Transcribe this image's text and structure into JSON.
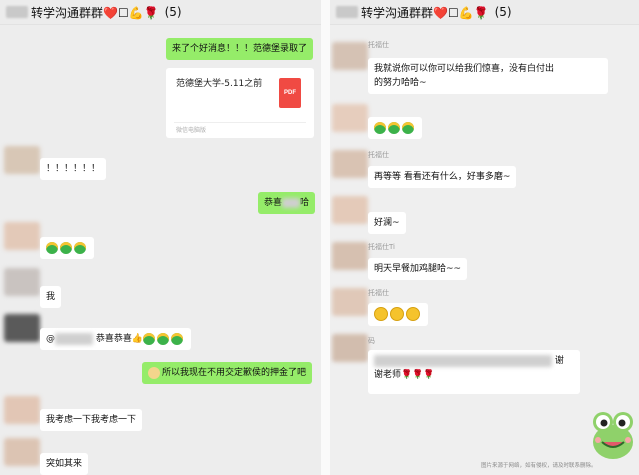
{
  "left": {
    "header": {
      "title": "转学沟通群群❤️☐💪🌹",
      "count": "(5)"
    },
    "messages": {
      "m1": "来了个好消息！！！范德堡录取了",
      "file_name": "范德堡大学-5.11之前",
      "file_badge": "PDF",
      "file_source": "微信电脑版",
      "m3": "！！！！！！",
      "m4_prefix": "恭喜",
      "m4_suffix": "哈",
      "m6": "我",
      "m7_prefix": "@",
      "m7_text": "恭喜恭喜👍",
      "m8": "所以我现在不用交定歉侯的押金了吧",
      "m9": "我考虑一下我考虑一下",
      "m10": "突如其来"
    }
  },
  "right": {
    "header": {
      "title": "转学沟通群群❤️☐💪🌹",
      "count": "(5)"
    },
    "nicks": {
      "n1": "托福仕",
      "n2": "托福仕",
      "n3": "托福仕Ti",
      "n4": "托福仕",
      "n5": "码"
    },
    "messages": {
      "r1_line1": "我就说你可以你可以给我们惊喜，没有白付出",
      "r1_line2": "的努力哈哈~",
      "r3": "再等等 看看还有什么，好事多磨~",
      "r4": "好澜~",
      "r5": "明天早餐加鸡腿哈~~",
      "r7_suffix": "谢",
      "r7_line2": "谢老师🌹🌹🌹"
    }
  },
  "watermark": "图片来源于网络，如有侵权，请及时联系删除。",
  "colors": {
    "bubble_green": "#95ec69",
    "bubble_white": "#ffffff",
    "pdf_red": "#f04a43"
  }
}
